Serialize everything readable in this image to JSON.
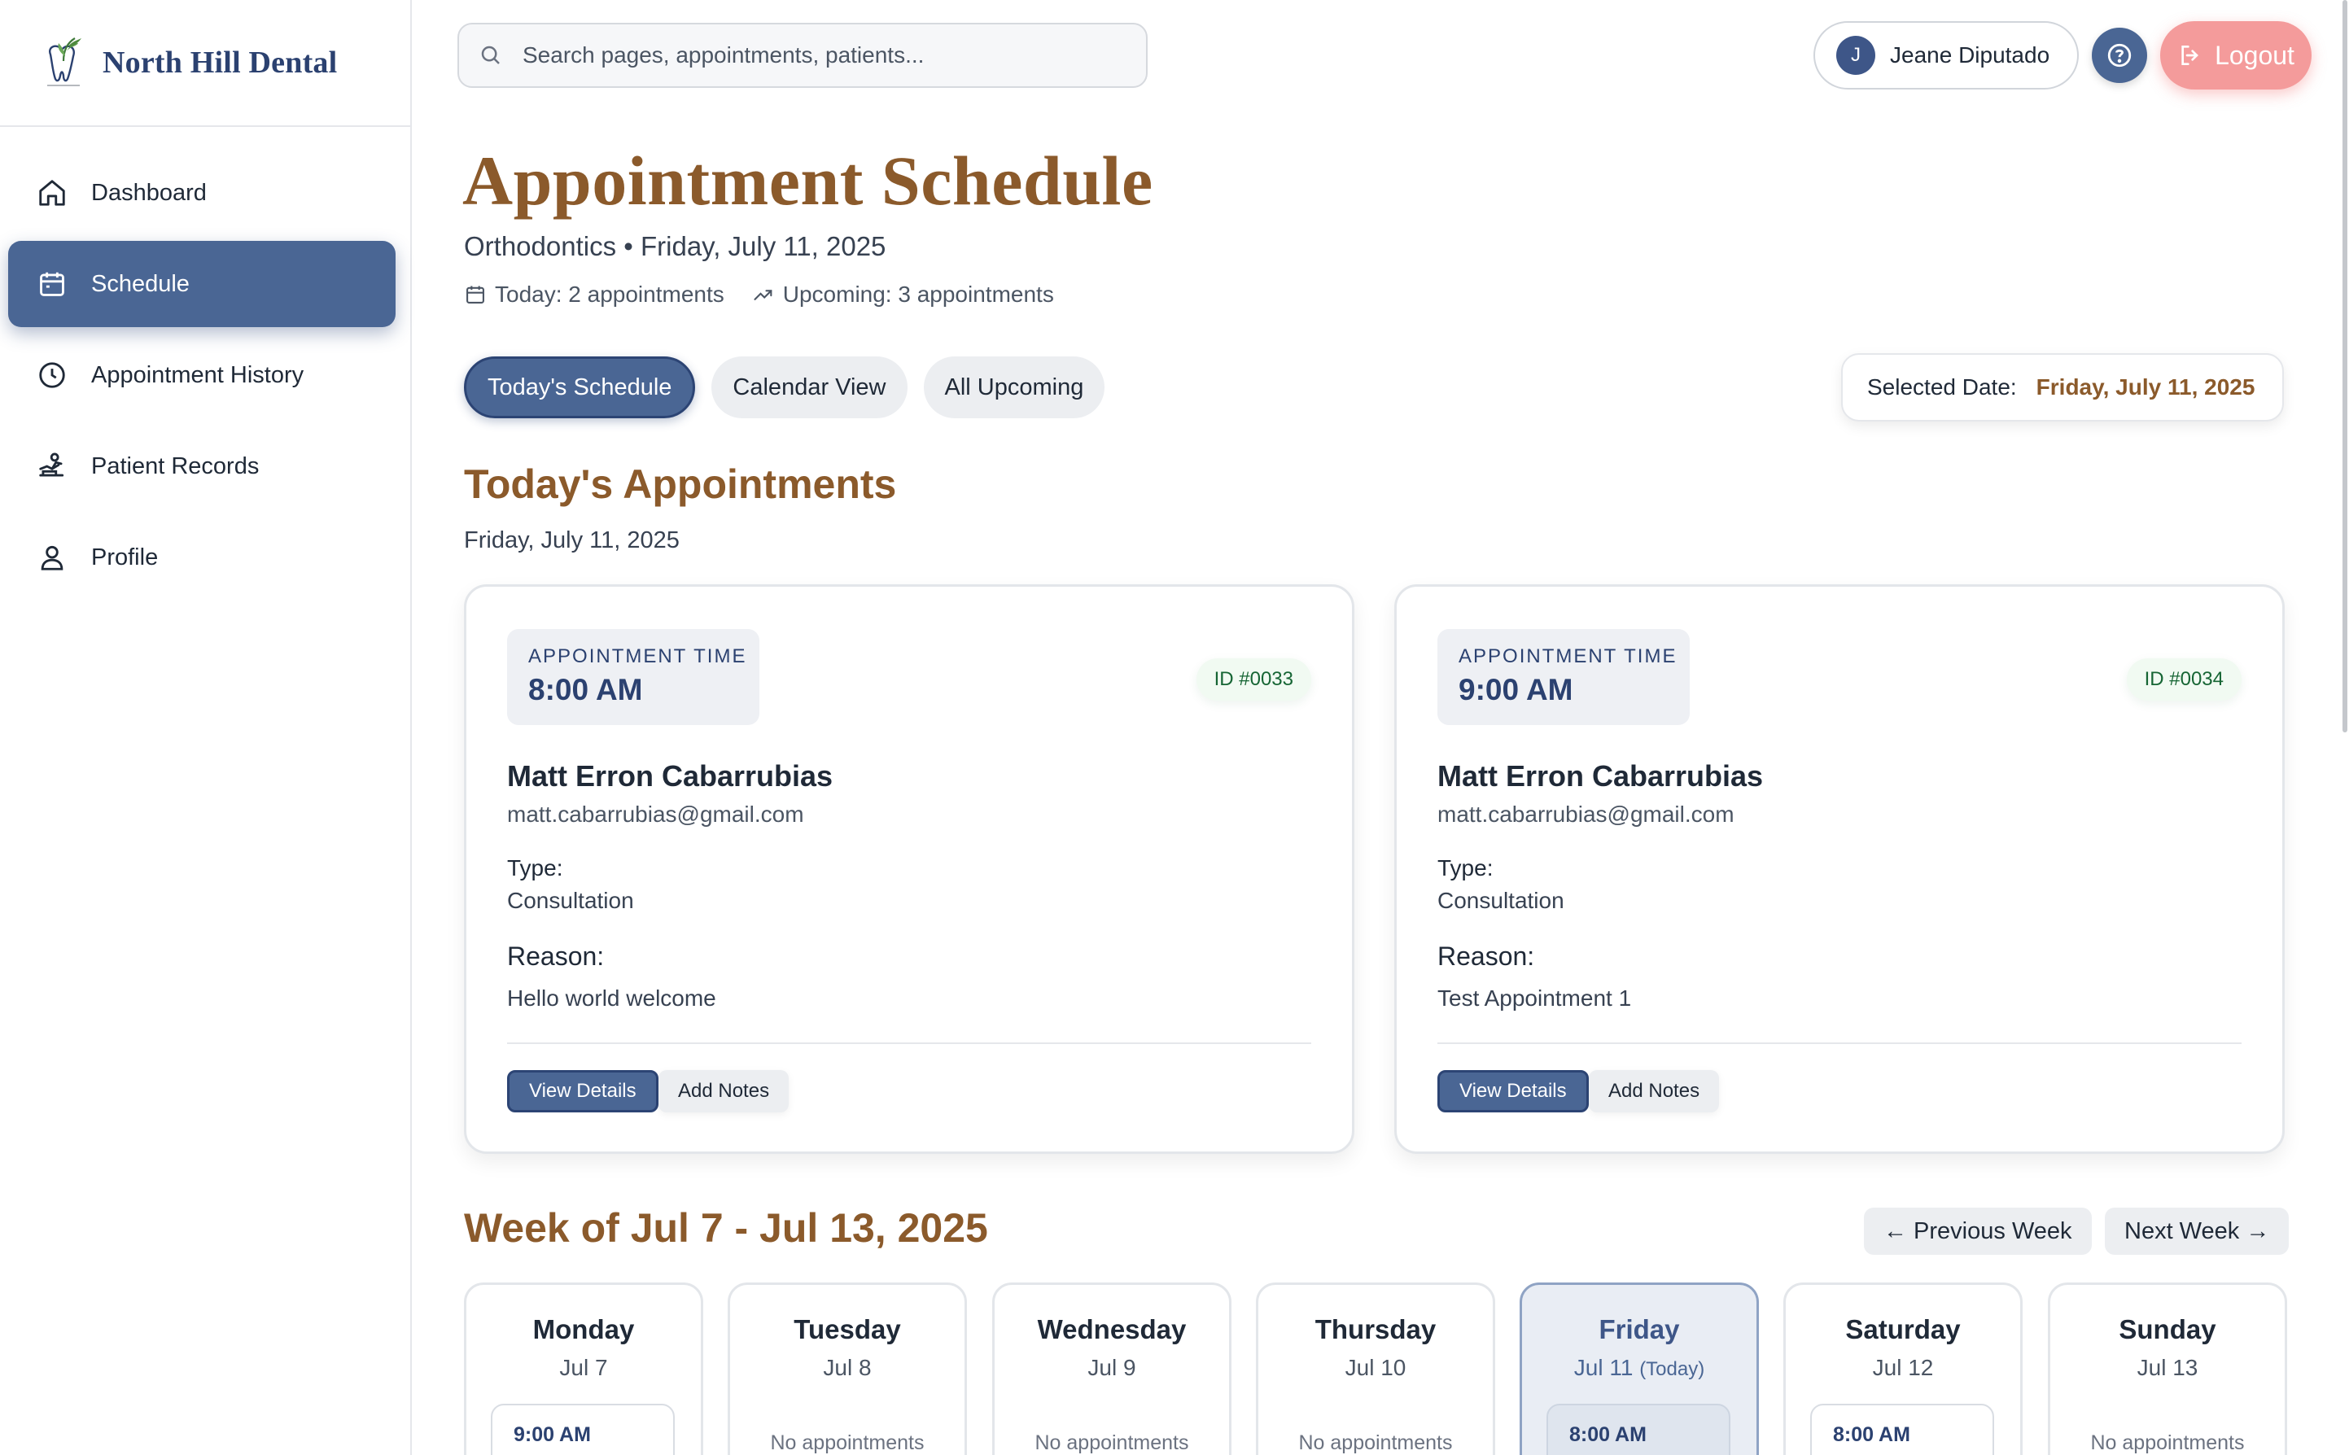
{
  "brand": {
    "name": "North Hill Dental",
    "logo_icon": "tooth-leaf-logo"
  },
  "sidebar": {
    "items": [
      {
        "label": "Dashboard",
        "icon": "home-icon",
        "active": false
      },
      {
        "label": "Schedule",
        "icon": "calendar-icon",
        "active": true
      },
      {
        "label": "Appointment History",
        "icon": "clock-icon",
        "active": false
      },
      {
        "label": "Patient Records",
        "icon": "patient-records-icon",
        "active": false
      },
      {
        "label": "Profile",
        "icon": "user-icon",
        "active": false
      }
    ]
  },
  "topbar": {
    "search_placeholder": "Search pages, appointments, patients...",
    "user": {
      "initial": "J",
      "name": "Jeane Diputado"
    },
    "logout_label": "Logout"
  },
  "header": {
    "title": "Appointment Schedule",
    "subtitle": "Orthodontics • Friday, July 11, 2025",
    "stats": {
      "today": "Today: 2 appointments",
      "upcoming": "Upcoming: 3 appointments"
    }
  },
  "tabs": [
    {
      "label": "Today's Schedule",
      "active": true
    },
    {
      "label": "Calendar View",
      "active": false
    },
    {
      "label": "All Upcoming",
      "active": false
    }
  ],
  "selected_date": {
    "label": "Selected Date:",
    "value": "Friday, July 11, 2025"
  },
  "today_section": {
    "title": "Today's Appointments",
    "date": "Friday, July 11, 2025",
    "appointments": [
      {
        "time_label": "APPOINTMENT TIME",
        "time": "8:00 AM",
        "id": "ID #0033",
        "patient_name": "Matt Erron Cabarrubias",
        "email": "matt.cabarrubias@gmail.com",
        "type_label": "Type:",
        "type": "Consultation",
        "reason_label": "Reason:",
        "reason": "Hello world welcome",
        "view_label": "View Details",
        "notes_label": "Add Notes"
      },
      {
        "time_label": "APPOINTMENT TIME",
        "time": "9:00 AM",
        "id": "ID #0034",
        "patient_name": "Matt Erron Cabarrubias",
        "email": "matt.cabarrubias@gmail.com",
        "type_label": "Type:",
        "type": "Consultation",
        "reason_label": "Reason:",
        "reason": "Test Appointment 1",
        "view_label": "View Details",
        "notes_label": "Add Notes"
      }
    ]
  },
  "week": {
    "title": "Week of Jul 7 - Jul 13, 2025",
    "prev_label": "← Previous Week",
    "next_label": "Next Week →",
    "days": [
      {
        "name": "Monday",
        "date": "Jul 7",
        "suffix": "",
        "slot": "9:00 AM",
        "empty": ""
      },
      {
        "name": "Tuesday",
        "date": "Jul 8",
        "suffix": "",
        "slot": "",
        "empty": "No appointments"
      },
      {
        "name": "Wednesday",
        "date": "Jul 9",
        "suffix": "",
        "slot": "",
        "empty": "No appointments"
      },
      {
        "name": "Thursday",
        "date": "Jul 10",
        "suffix": "",
        "slot": "",
        "empty": "No appointments"
      },
      {
        "name": "Friday",
        "date": "Jul 11",
        "suffix": "(Today)",
        "slot": "8:00 AM",
        "empty": ""
      },
      {
        "name": "Saturday",
        "date": "Jul 12",
        "suffix": "",
        "slot": "8:00 AM",
        "empty": ""
      },
      {
        "name": "Sunday",
        "date": "Jul 13",
        "suffix": "",
        "slot": "",
        "empty": "No appointments"
      }
    ]
  },
  "colors": {
    "accent": "#4a6694",
    "brand_brown": "#8b5a2b",
    "navy": "#2b4170",
    "logout": "#f49b9b"
  }
}
